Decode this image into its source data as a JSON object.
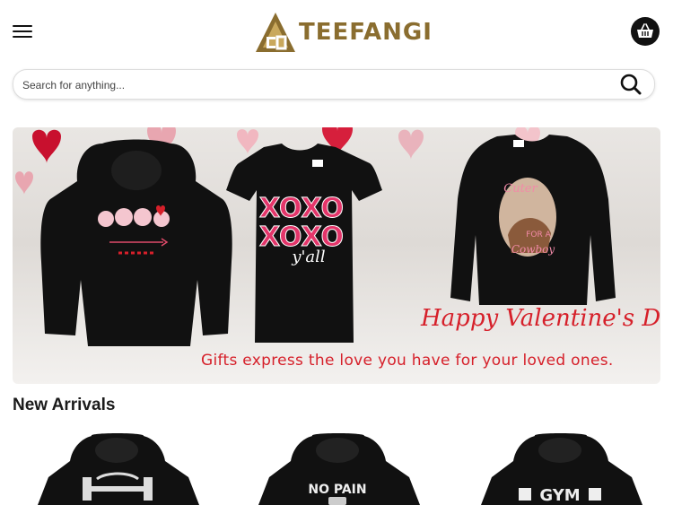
{
  "header": {
    "menu_icon": "hamburger-menu-icon",
    "brand": "TEEFANGI",
    "cart_icon": "shopping-basket-icon"
  },
  "search": {
    "placeholder": "Search for anything...",
    "icon": "search-icon"
  },
  "banner": {
    "title": "Happy Valentine's Day",
    "subtitle": "Gifts express the love you have for your loved ones.",
    "products": [
      {
        "type": "hoodie",
        "graphic": "ghosts"
      },
      {
        "type": "t-shirt",
        "graphic": "xoxo",
        "text_lines": [
          "XOXO",
          "XOXO",
          "y'all"
        ]
      },
      {
        "type": "sweatshirt",
        "graphic": "cowgirl",
        "text_lines": [
          "Cuter",
          "For A",
          "Cowboy"
        ]
      }
    ]
  },
  "new_arrivals": {
    "title": "New Arrivals",
    "products": [
      {
        "graphic": "barbell",
        "text": ""
      },
      {
        "graphic": "no-pain",
        "text": "NO PAIN"
      },
      {
        "graphic": "gym",
        "text": "GYM"
      }
    ]
  },
  "colors": {
    "brand_gold": "#8a6d2f",
    "accent_red": "#d6202a",
    "dark": "#111111"
  }
}
